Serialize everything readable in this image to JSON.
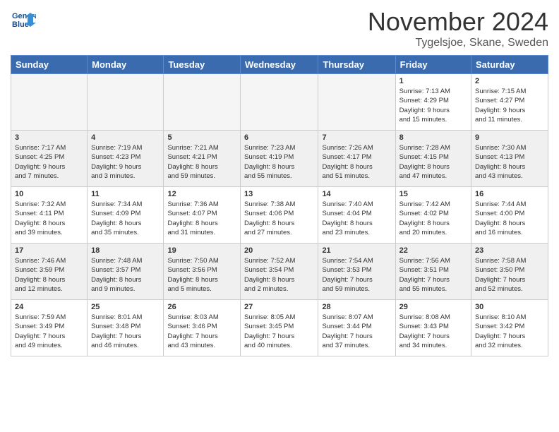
{
  "header": {
    "logo_line1": "General",
    "logo_line2": "Blue",
    "month": "November 2024",
    "location": "Tygelsjoe, Skane, Sweden"
  },
  "days_of_week": [
    "Sunday",
    "Monday",
    "Tuesday",
    "Wednesday",
    "Thursday",
    "Friday",
    "Saturday"
  ],
  "weeks": [
    [
      {
        "num": "",
        "info": ""
      },
      {
        "num": "",
        "info": ""
      },
      {
        "num": "",
        "info": ""
      },
      {
        "num": "",
        "info": ""
      },
      {
        "num": "",
        "info": ""
      },
      {
        "num": "1",
        "info": "Sunrise: 7:13 AM\nSunset: 4:29 PM\nDaylight: 9 hours\nand 15 minutes."
      },
      {
        "num": "2",
        "info": "Sunrise: 7:15 AM\nSunset: 4:27 PM\nDaylight: 9 hours\nand 11 minutes."
      }
    ],
    [
      {
        "num": "3",
        "info": "Sunrise: 7:17 AM\nSunset: 4:25 PM\nDaylight: 9 hours\nand 7 minutes."
      },
      {
        "num": "4",
        "info": "Sunrise: 7:19 AM\nSunset: 4:23 PM\nDaylight: 9 hours\nand 3 minutes."
      },
      {
        "num": "5",
        "info": "Sunrise: 7:21 AM\nSunset: 4:21 PM\nDaylight: 8 hours\nand 59 minutes."
      },
      {
        "num": "6",
        "info": "Sunrise: 7:23 AM\nSunset: 4:19 PM\nDaylight: 8 hours\nand 55 minutes."
      },
      {
        "num": "7",
        "info": "Sunrise: 7:26 AM\nSunset: 4:17 PM\nDaylight: 8 hours\nand 51 minutes."
      },
      {
        "num": "8",
        "info": "Sunrise: 7:28 AM\nSunset: 4:15 PM\nDaylight: 8 hours\nand 47 minutes."
      },
      {
        "num": "9",
        "info": "Sunrise: 7:30 AM\nSunset: 4:13 PM\nDaylight: 8 hours\nand 43 minutes."
      }
    ],
    [
      {
        "num": "10",
        "info": "Sunrise: 7:32 AM\nSunset: 4:11 PM\nDaylight: 8 hours\nand 39 minutes."
      },
      {
        "num": "11",
        "info": "Sunrise: 7:34 AM\nSunset: 4:09 PM\nDaylight: 8 hours\nand 35 minutes."
      },
      {
        "num": "12",
        "info": "Sunrise: 7:36 AM\nSunset: 4:07 PM\nDaylight: 8 hours\nand 31 minutes."
      },
      {
        "num": "13",
        "info": "Sunrise: 7:38 AM\nSunset: 4:06 PM\nDaylight: 8 hours\nand 27 minutes."
      },
      {
        "num": "14",
        "info": "Sunrise: 7:40 AM\nSunset: 4:04 PM\nDaylight: 8 hours\nand 23 minutes."
      },
      {
        "num": "15",
        "info": "Sunrise: 7:42 AM\nSunset: 4:02 PM\nDaylight: 8 hours\nand 20 minutes."
      },
      {
        "num": "16",
        "info": "Sunrise: 7:44 AM\nSunset: 4:00 PM\nDaylight: 8 hours\nand 16 minutes."
      }
    ],
    [
      {
        "num": "17",
        "info": "Sunrise: 7:46 AM\nSunset: 3:59 PM\nDaylight: 8 hours\nand 12 minutes."
      },
      {
        "num": "18",
        "info": "Sunrise: 7:48 AM\nSunset: 3:57 PM\nDaylight: 8 hours\nand 9 minutes."
      },
      {
        "num": "19",
        "info": "Sunrise: 7:50 AM\nSunset: 3:56 PM\nDaylight: 8 hours\nand 5 minutes."
      },
      {
        "num": "20",
        "info": "Sunrise: 7:52 AM\nSunset: 3:54 PM\nDaylight: 8 hours\nand 2 minutes."
      },
      {
        "num": "21",
        "info": "Sunrise: 7:54 AM\nSunset: 3:53 PM\nDaylight: 7 hours\nand 59 minutes."
      },
      {
        "num": "22",
        "info": "Sunrise: 7:56 AM\nSunset: 3:51 PM\nDaylight: 7 hours\nand 55 minutes."
      },
      {
        "num": "23",
        "info": "Sunrise: 7:58 AM\nSunset: 3:50 PM\nDaylight: 7 hours\nand 52 minutes."
      }
    ],
    [
      {
        "num": "24",
        "info": "Sunrise: 7:59 AM\nSunset: 3:49 PM\nDaylight: 7 hours\nand 49 minutes."
      },
      {
        "num": "25",
        "info": "Sunrise: 8:01 AM\nSunset: 3:48 PM\nDaylight: 7 hours\nand 46 minutes."
      },
      {
        "num": "26",
        "info": "Sunrise: 8:03 AM\nSunset: 3:46 PM\nDaylight: 7 hours\nand 43 minutes."
      },
      {
        "num": "27",
        "info": "Sunrise: 8:05 AM\nSunset: 3:45 PM\nDaylight: 7 hours\nand 40 minutes."
      },
      {
        "num": "28",
        "info": "Sunrise: 8:07 AM\nSunset: 3:44 PM\nDaylight: 7 hours\nand 37 minutes."
      },
      {
        "num": "29",
        "info": "Sunrise: 8:08 AM\nSunset: 3:43 PM\nDaylight: 7 hours\nand 34 minutes."
      },
      {
        "num": "30",
        "info": "Sunrise: 8:10 AM\nSunset: 3:42 PM\nDaylight: 7 hours\nand 32 minutes."
      }
    ]
  ]
}
